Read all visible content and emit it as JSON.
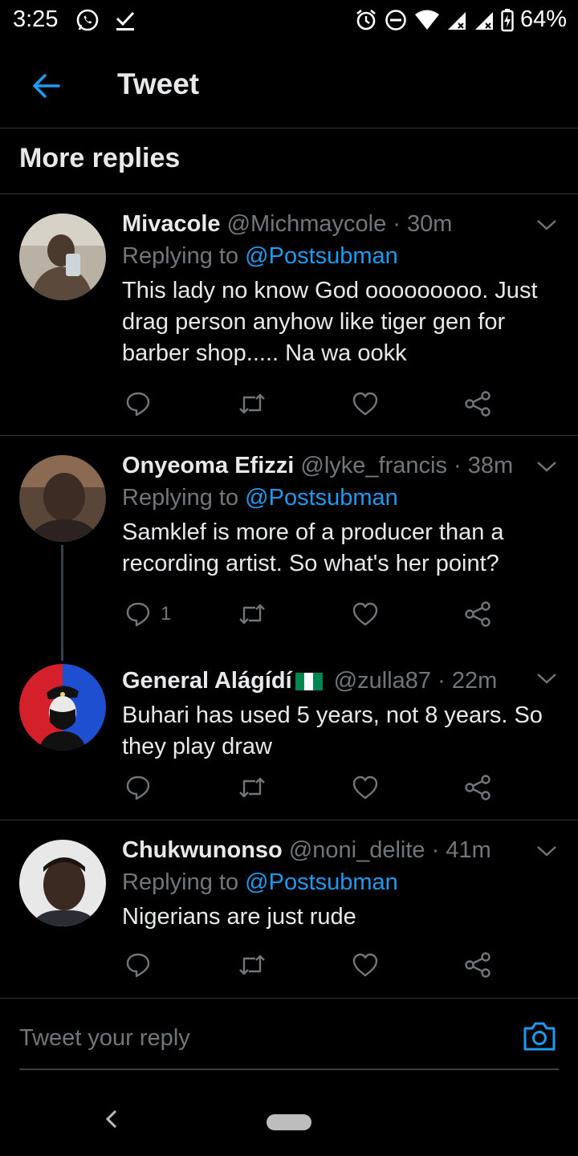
{
  "status_bar": {
    "time": "3:25",
    "battery": "64%",
    "left_icons": [
      "whatsapp-icon",
      "check-download-icon"
    ],
    "right_icons": [
      "alarm-icon",
      "do-not-disturb-icon",
      "wifi-icon",
      "signal-icon",
      "signal-icon",
      "battery-charging-icon"
    ]
  },
  "header": {
    "title": "Tweet",
    "back_icon": "arrow-left-icon"
  },
  "section": {
    "title": "More replies"
  },
  "tweets": [
    {
      "name": "Mivacole",
      "handle": "@Michmaycole",
      "time": "· 30m",
      "replying_label": "Replying to",
      "replying_to": "@Postsubman",
      "text": "This lady no know God ooooooooo. Just drag person anyhow like tiger gen for barber shop..... Na wa ookk",
      "reply_count": "",
      "avatar_colors": [
        "#b9b1a4",
        "#5b4a3b"
      ]
    },
    {
      "name": "Onyeoma Efizzi",
      "handle": "@lyke_francis",
      "time": "· 38m",
      "replying_label": "Replying to",
      "replying_to": "@Postsubman",
      "text": "Samklef is more of a producer than a recording artist. So what's her point?",
      "reply_count": "1",
      "avatar_colors": [
        "#8a6a52",
        "#2c2320"
      ]
    },
    {
      "name": "General Alágídí",
      "handle": "@zulla87",
      "time": "· 22m",
      "text": "Buhari has used 5 years, not 8 years. So they play draw",
      "reply_count": "",
      "flag_colors": [
        "#008751",
        "#ffffff",
        "#008751"
      ]
    },
    {
      "name": "Chukwunonso",
      "handle": "@noni_delite",
      "time": "· 41m",
      "replying_label": "Replying to",
      "replying_to": "@Postsubman",
      "text": "Nigerians are just rude",
      "reply_count": "",
      "avatar_colors": [
        "#e8e8e8",
        "#3b2a22"
      ]
    }
  ],
  "composer": {
    "placeholder": "Tweet your reply",
    "camera_icon": "camera-icon"
  },
  "colors": {
    "accent": "#1d9bf0",
    "background": "#000000",
    "muted": "#71767b",
    "text": "#e7e9ea"
  }
}
